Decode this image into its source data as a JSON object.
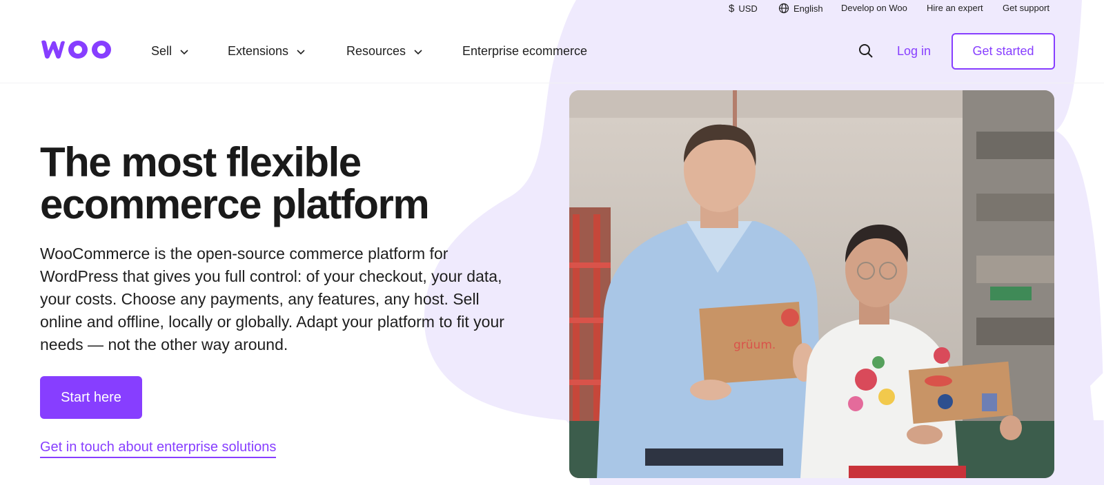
{
  "utility": {
    "currency": "USD",
    "language": "English",
    "develop": "Develop on Woo",
    "hire": "Hire an expert",
    "support": "Get support"
  },
  "nav": {
    "logo_text": "woo",
    "items": [
      {
        "label": "Sell",
        "has_dropdown": true
      },
      {
        "label": "Extensions",
        "has_dropdown": true
      },
      {
        "label": "Resources",
        "has_dropdown": true
      },
      {
        "label": "Enterprise ecommerce",
        "has_dropdown": false
      }
    ],
    "search_icon": "search-icon",
    "login": "Log in",
    "get_started": "Get started"
  },
  "hero": {
    "title_line1": "The most flexible",
    "title_line2": "ecommerce platform",
    "body": "WooCommerce is the open-source commerce platform for WordPress that gives you full control: of your checkout, your data, your costs. Choose any payments, any features, any host. Sell online and offline, locally or globally. Adapt your platform to fit your needs — not the other way around.",
    "cta_primary": "Start here",
    "cta_link": "Get in touch about enterprise solutions",
    "box_brand": "grüum."
  },
  "colors": {
    "brand_purple": "#873eff",
    "blob_lavender": "#efeafd",
    "text_dark": "#1e1e1e"
  }
}
